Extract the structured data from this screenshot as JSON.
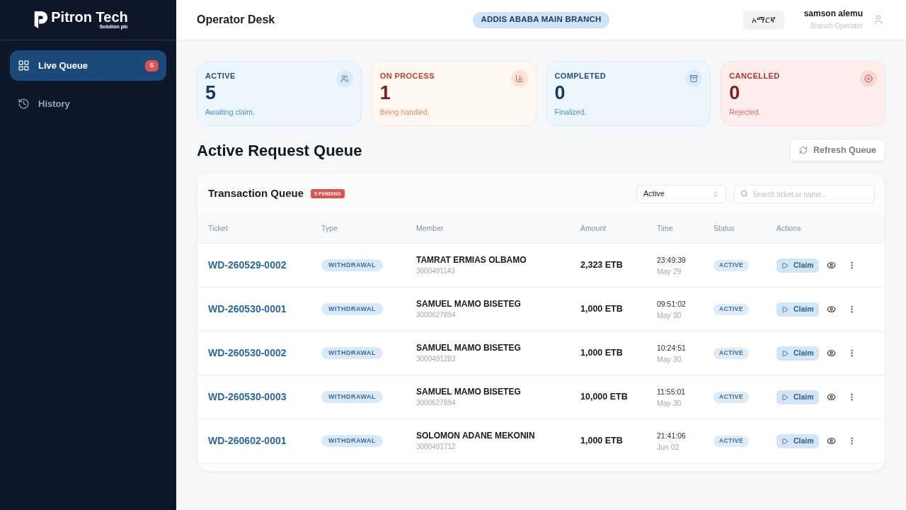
{
  "sidebar": {
    "brand": {
      "name": "Pitron Tech",
      "tagline": "Solution plc"
    },
    "items": [
      {
        "label": "Live Queue",
        "selected": true,
        "badge": "5"
      },
      {
        "label": "History",
        "selected": false
      }
    ]
  },
  "header": {
    "title": "Operator Desk",
    "branch": "ADDIS ABABA MAIN BRANCH",
    "language": "አማርኛ",
    "user": {
      "name": "samson alemu",
      "role": "Branch Operator"
    }
  },
  "stats": [
    {
      "label": "ACTIVE",
      "value": "5",
      "caption": "Awaiting claim.",
      "kind": "info"
    },
    {
      "label": "ON PROCESS",
      "value": "1",
      "caption": "Being handled.",
      "kind": "warning"
    },
    {
      "label": "COMPLETED",
      "value": "0",
      "caption": "Finalized.",
      "kind": "info"
    },
    {
      "label": "CANCELLED",
      "value": "0",
      "caption": "Rejected.",
      "kind": "danger"
    }
  ],
  "queue": {
    "title": "Active Request Queue",
    "refresh_button": "Refresh Queue"
  },
  "table": {
    "title": "Transaction Queue",
    "badge": "5 PENDING",
    "filter": {
      "value": "Active"
    },
    "search": {
      "placeholder": "Search ticket or name..."
    },
    "columns": [
      "Ticket",
      "Type",
      "Member",
      "Amount",
      "Time",
      "Status",
      "Actions"
    ],
    "rows": [
      {
        "ticket": "WD-260529-0002",
        "type": "WITHDRAWAL",
        "member": {
          "name": "TAMRAT ERMIAS OLBAMO",
          "account": "3000491143"
        },
        "amount": "2,323 ETB",
        "time": "23:49:39",
        "date": "May 29",
        "status": "ACTIVE",
        "action": "Claim"
      },
      {
        "ticket": "WD-260530-0001",
        "type": "WITHDRAWAL",
        "member": {
          "name": "SAMUEL MAMO BISETEG",
          "account": "3000627894"
        },
        "amount": "1,000 ETB",
        "time": "09:51:02",
        "date": "May 30",
        "status": "ACTIVE",
        "action": "Claim"
      },
      {
        "ticket": "WD-260530-0002",
        "type": "WITHDRAWAL",
        "member": {
          "name": "SAMUEL MAMO BISETEG",
          "account": "3000491283"
        },
        "amount": "1,000 ETB",
        "time": "10:24:51",
        "date": "May 30",
        "status": "ACTIVE",
        "action": "Claim"
      },
      {
        "ticket": "WD-260530-0003",
        "type": "WITHDRAWAL",
        "member": {
          "name": "SAMUEL MAMO BISETEG",
          "account": "3000627894"
        },
        "amount": "10,000 ETB",
        "time": "11:55:01",
        "date": "May 30",
        "status": "ACTIVE",
        "action": "Claim"
      },
      {
        "ticket": "WD-260602-0001",
        "type": "WITHDRAWAL",
        "member": {
          "name": "SOLOMON ADANE MEKONIN",
          "account": "3000491712"
        },
        "amount": "1,000 ETB",
        "time": "21:41:06",
        "date": "Jun 02",
        "status": "ACTIVE",
        "action": "Claim"
      }
    ]
  }
}
